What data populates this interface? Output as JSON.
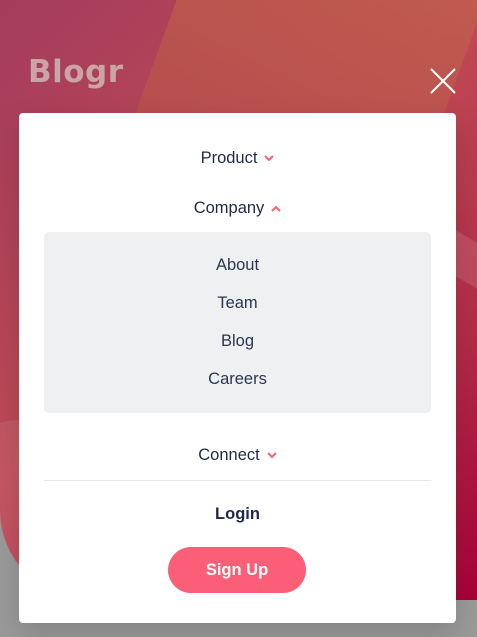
{
  "header": {
    "logo_text": "Blogr",
    "close_icon": "close-icon"
  },
  "menu": {
    "items": [
      {
        "label": "Product",
        "icon": "chevron-down-icon",
        "expanded": false
      },
      {
        "label": "Company",
        "icon": "chevron-up-icon",
        "expanded": true,
        "subitems": [
          "About",
          "Team",
          "Blog",
          "Careers"
        ]
      },
      {
        "label": "Connect",
        "icon": "chevron-down-icon",
        "expanded": false
      }
    ],
    "login_label": "Login",
    "signup_label": "Sign Up"
  },
  "colors": {
    "accent": "#fb5f78",
    "text_dark": "#1e2a4a",
    "submenu_bg": "#eff0f2",
    "logo": "#c9a5a6"
  }
}
